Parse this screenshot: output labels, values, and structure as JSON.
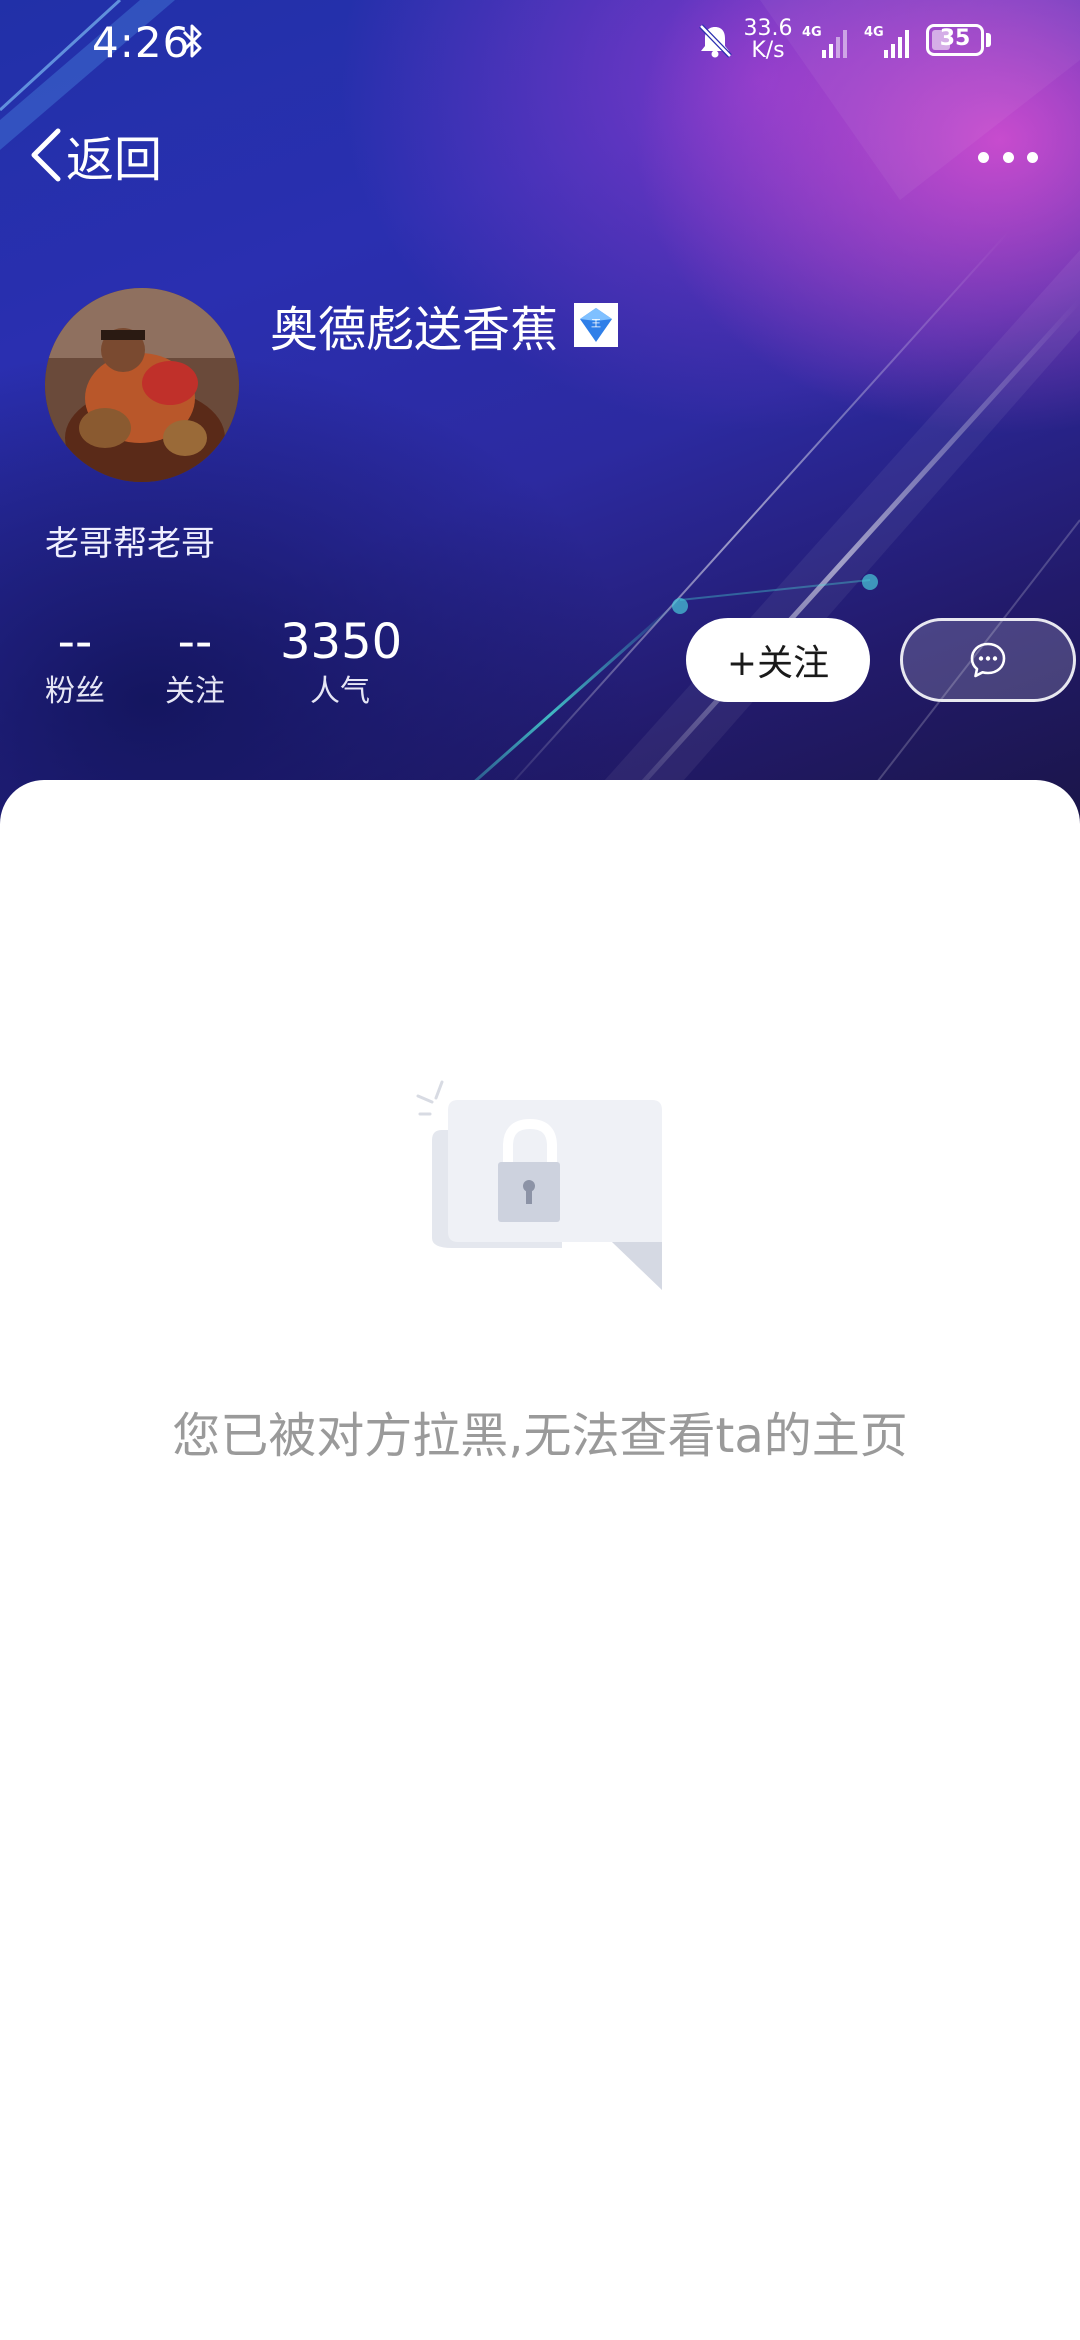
{
  "status_bar": {
    "time": "4:26",
    "net_speed_value": "33.6",
    "net_speed_unit": "K/s",
    "signal1_label": "4G",
    "signal2_label": "4G",
    "battery": "35"
  },
  "nav": {
    "back_label": "返回"
  },
  "profile": {
    "username": "奥德彪送香蕉",
    "bio": "老哥帮老哥",
    "stats": {
      "fans_value": "--",
      "fans_label": "粉丝",
      "following_value": "--",
      "following_label": "关注",
      "popularity_value": "3350",
      "popularity_label": "人气"
    },
    "follow_button_label": "+关注"
  },
  "content": {
    "blocked_message": "您已被对方拉黑,无法查看ta的主页"
  },
  "icons": {
    "bluetooth": "bluetooth-icon",
    "mute": "bell-off-icon",
    "back": "chevron-left-icon",
    "more": "more-dots-icon",
    "badge": "diamond-badge-icon",
    "message": "chat-bubble-icon",
    "lock": "lock-icon"
  },
  "colors": {
    "hero_primary": "#2a2fb0",
    "hero_accent": "#dd50d2",
    "message_text": "#9a9a9a"
  }
}
